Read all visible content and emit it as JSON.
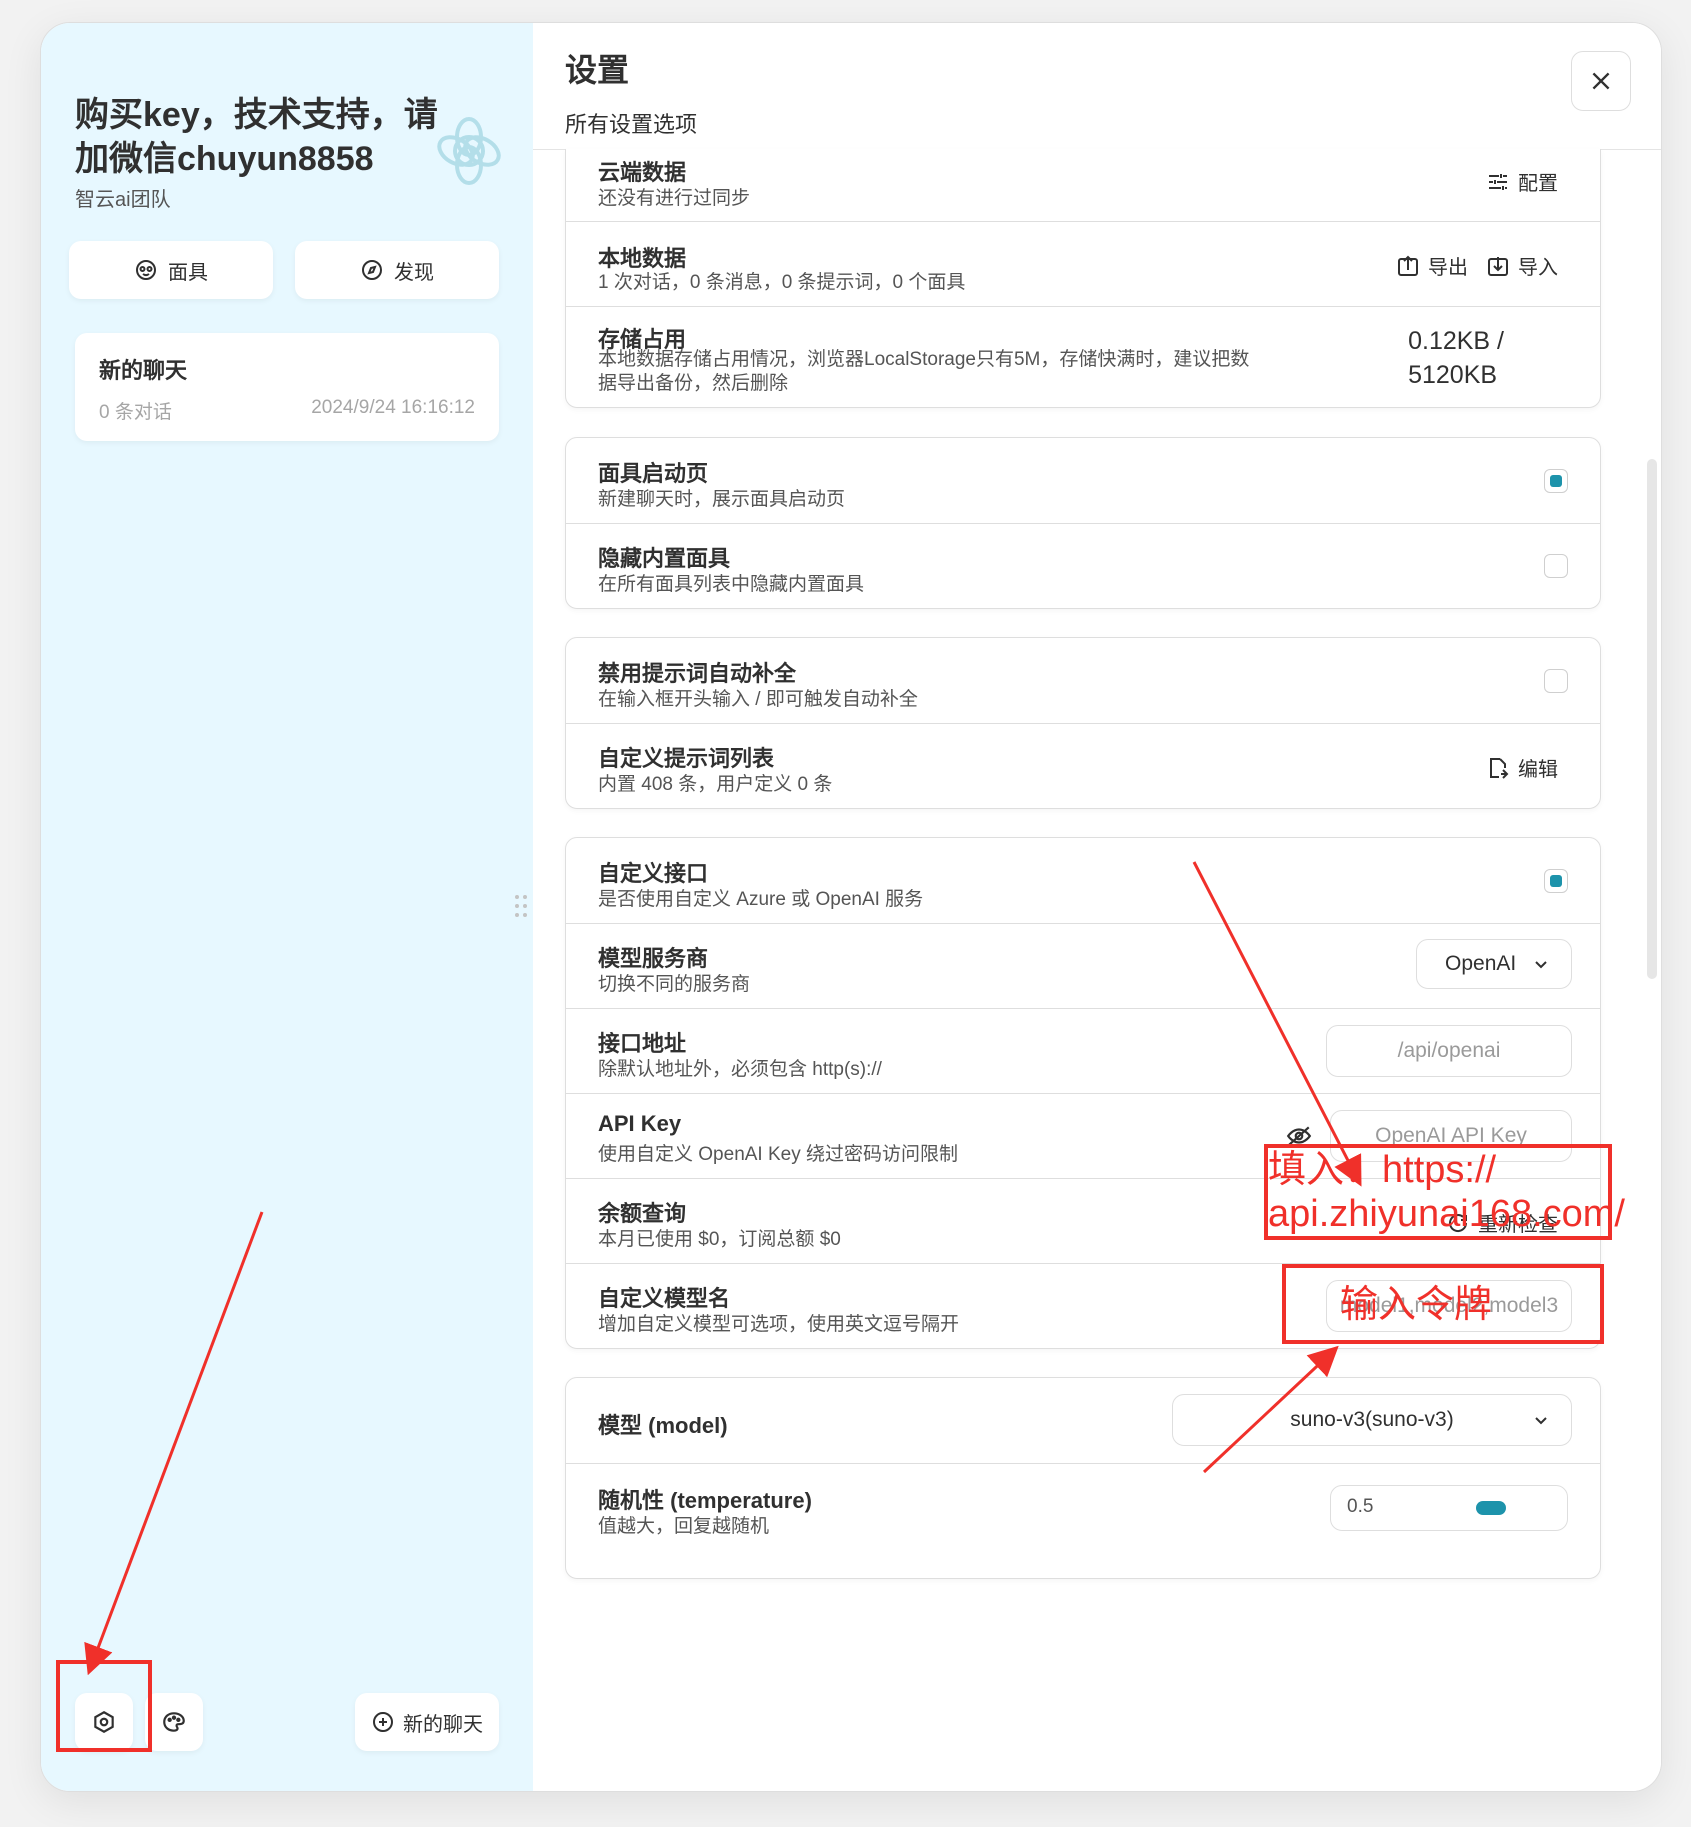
{
  "sidebar": {
    "title": "购买key，技术支持，请加微信chuyun8858",
    "subtitle": "智云ai团队",
    "mask_button": "面具",
    "discover_button": "发现",
    "chat": {
      "title": "新的聊天",
      "count": "0 条对话",
      "time": "2024/9/24 16:16:12"
    },
    "new_chat_button": "新的聊天"
  },
  "header": {
    "title": "设置",
    "subtitle": "所有设置选项"
  },
  "data_section": {
    "cloud": {
      "title": "云端数据",
      "subtitle": "还没有进行过同步",
      "action": "配置"
    },
    "local": {
      "title": "本地数据",
      "subtitle": "1 次对话，0 条消息，0 条提示词，0 个面具",
      "export": "导出",
      "import": "导入"
    },
    "storage": {
      "title": "存储占用",
      "subtitle": "本地数据存储占用情况，浏览器LocalStorage只有5M，存储快满时，建议把数据导出备份，然后删除",
      "value_line1": "0.12KB /",
      "value_line2": "5120KB"
    }
  },
  "mask_section": {
    "splash": {
      "title": "面具启动页",
      "subtitle": "新建聊天时，展示面具启动页",
      "checked": true
    },
    "hide_builtin": {
      "title": "隐藏内置面具",
      "subtitle": "在所有面具列表中隐藏内置面具",
      "checked": false
    }
  },
  "prompt_section": {
    "disable_autocomplete": {
      "title": "禁用提示词自动补全",
      "subtitle": "在输入框开头输入 / 即可触发自动补全",
      "checked": false
    },
    "custom_list": {
      "title": "自定义提示词列表",
      "subtitle": "内置 408 条，用户定义 0 条",
      "action": "编辑"
    }
  },
  "api_section": {
    "custom_endpoint": {
      "title": "自定义接口",
      "subtitle": "是否使用自定义 Azure 或 OpenAI 服务",
      "checked": true
    },
    "provider": {
      "title": "模型服务商",
      "subtitle": "切换不同的服务商",
      "value": "OpenAI"
    },
    "endpoint": {
      "title": "接口地址",
      "subtitle": "除默认地址外，必须包含 http(s)://",
      "placeholder": "/api/openai"
    },
    "api_key": {
      "title": "API Key",
      "subtitle": "使用自定义 OpenAI Key 绕过密码访问限制",
      "placeholder": "OpenAI API Key"
    },
    "balance": {
      "title": "余额查询",
      "subtitle": "本月已使用 $0，订阅总额 $0",
      "action": "重新检查"
    },
    "custom_models": {
      "title": "自定义模型名",
      "subtitle": "增加自定义模型可选项，使用英文逗号隔开",
      "placeholder": "model1,model2,model3"
    }
  },
  "model_section": {
    "model": {
      "title": "模型 (model)",
      "value": "suno-v3(suno-v3)"
    },
    "temperature": {
      "title": "随机性 (temperature)",
      "subtitle": "值越大，回复越随机",
      "value": "0.5",
      "fraction": 0.5
    }
  },
  "annotations": {
    "endpoint_hint_line1": "填入：https://",
    "endpoint_hint_line2": "api.zhiyunai168.com/",
    "key_hint": "输入令牌",
    "color": "#f0302a"
  },
  "colors": {
    "accent": "#1d93ab",
    "sidebar_bg": "#e7f8ff"
  },
  "icons": [
    "openai-logo-icon",
    "mask-icon",
    "compass-icon",
    "close-icon",
    "sliders-icon",
    "export-icon",
    "import-icon",
    "edit-icon",
    "chevron-down-icon",
    "eye-off-icon",
    "refresh-icon",
    "settings-icon",
    "palette-icon",
    "add-circle-icon",
    "drag-handle-icon"
  ]
}
